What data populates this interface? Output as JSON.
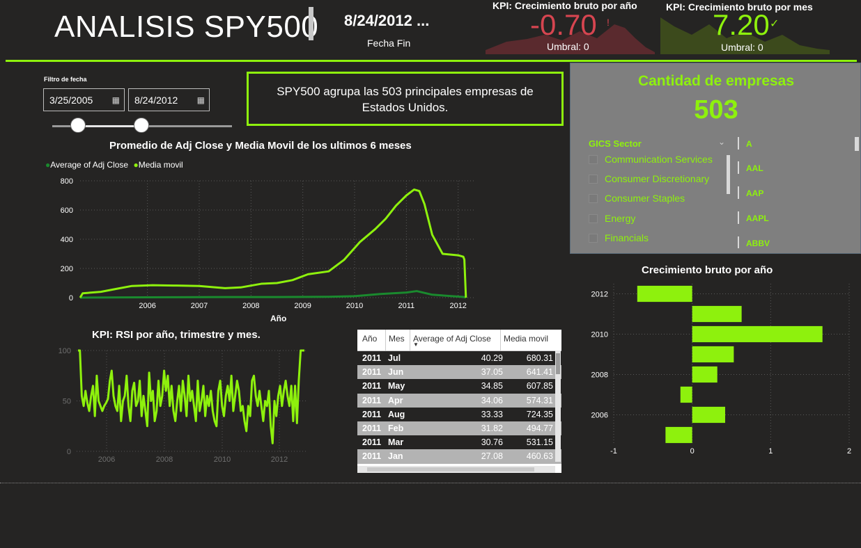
{
  "header": {
    "title": "ANALISIS SPY500",
    "end_date": "8/24/2012 ...",
    "end_date_label": "Fecha Fin"
  },
  "kpi_year": {
    "title": "KPI: Crecimiento bruto por año",
    "value": "-0.70",
    "indicator": "!",
    "threshold": "Umbral: 0",
    "color": "#d64550"
  },
  "kpi_month": {
    "title": "KPI: Crecimiento bruto por mes",
    "value": "7.20",
    "indicator": "✓",
    "threshold": "Umbral: 0",
    "color": "#8ef10d"
  },
  "filter": {
    "label": "Filtro de fecha",
    "start": "3/25/2005",
    "end": "8/24/2012",
    "calendar_icon": "calendar-icon"
  },
  "info_text": "SPY500 agrupa las 503 principales empresas de Estados Unidos.",
  "companies": {
    "title": "Cantidad de empresas",
    "count": "503"
  },
  "sector_slicer": {
    "header": "GICS Sector",
    "items": [
      "Communication Services",
      "Consumer Discretionary",
      "Consumer Staples",
      "Energy",
      "Financials"
    ]
  },
  "ticker_slicer": {
    "items": [
      "A",
      "AAL",
      "AAP",
      "AAPL",
      "ABBV"
    ]
  },
  "colors": {
    "accent": "#8ef10d",
    "dark_green": "#1a8a2e",
    "background": "#252423",
    "panel": "#7f7f7f"
  },
  "chart_data": [
    {
      "type": "line",
      "title": "Promedio de Adj Close y Media Movil de los ultimos 6 meses",
      "xlabel": "Año",
      "ylabel": "",
      "legend_placement": "top-left",
      "grid": true,
      "x_ticks": [
        "2006",
        "2007",
        "2008",
        "2009",
        "2010",
        "2011",
        "2012"
      ],
      "y_ticks": [
        "0",
        "200",
        "400",
        "600",
        "800"
      ],
      "xlim": [
        2005.2,
        2012.8
      ],
      "ylim": [
        0,
        800
      ],
      "series": [
        {
          "name": "Average of Adj Close",
          "color": "#1a8a2e",
          "x": [
            2005.2,
            2006,
            2007,
            2008,
            2009,
            2010,
            2010.5,
            2011,
            2011.5,
            2011.7,
            2012,
            2012.6,
            2012.65
          ],
          "values": [
            0,
            2,
            3,
            4,
            4,
            6,
            10,
            25,
            35,
            45,
            20,
            5,
            0
          ]
        },
        {
          "name": "Media movil",
          "color": "#8ef10d",
          "x": [
            2005.2,
            2005.25,
            2005.6,
            2005.9,
            2006.2,
            2006.6,
            2007,
            2007.5,
            2008,
            2008.3,
            2008.7,
            2009,
            2009.3,
            2009.6,
            2010,
            2010.3,
            2010.6,
            2010.9,
            2011.1,
            2011.3,
            2011.5,
            2011.65,
            2011.75,
            2011.85,
            2012,
            2012.2,
            2012.5,
            2012.6,
            2012.62,
            2012.65
          ],
          "values": [
            0,
            30,
            40,
            60,
            80,
            85,
            83,
            80,
            65,
            70,
            95,
            100,
            120,
            160,
            180,
            260,
            380,
            470,
            540,
            630,
            700,
            740,
            730,
            640,
            430,
            300,
            290,
            280,
            260,
            0
          ]
        }
      ]
    },
    {
      "type": "line",
      "title": "KPI: RSI por año, trimestre y mes.",
      "xlabel": "",
      "ylabel": "",
      "grid": true,
      "x_ticks": [
        "2006",
        "2008",
        "2010",
        "2012"
      ],
      "y_ticks": [
        "0",
        "50",
        "100"
      ],
      "ylim": [
        0,
        100
      ],
      "series": [
        {
          "name": "",
          "color": "#8ef10d",
          "values": [
            100,
            100,
            55,
            45,
            60,
            48,
            40,
            55,
            65,
            35,
            75,
            50,
            45,
            40,
            45,
            48,
            52,
            70,
            80,
            55,
            45,
            40,
            65,
            30,
            50,
            55,
            75,
            45,
            30,
            60,
            68,
            45,
            50,
            70,
            35,
            55,
            40,
            25,
            78,
            50,
            60,
            30,
            40,
            70,
            45,
            55,
            80,
            60,
            75,
            45,
            65,
            40,
            30,
            50,
            65,
            40,
            70,
            55,
            35,
            75,
            50,
            60,
            45,
            30,
            70,
            40,
            50,
            65,
            35,
            55,
            45,
            60,
            40,
            30,
            25,
            60,
            70,
            45,
            35,
            55,
            65,
            50,
            75,
            40,
            55,
            70,
            60,
            40,
            45,
            30,
            20,
            45,
            35,
            70,
            75,
            55,
            45,
            60,
            45,
            30,
            50,
            45,
            60,
            25,
            8,
            50,
            35,
            55,
            65,
            45,
            60,
            70,
            55,
            45,
            65,
            30,
            65,
            28,
            70,
            100,
            100,
            100
          ]
        }
      ]
    },
    {
      "type": "table",
      "columns": [
        "Año",
        "Mes",
        "Average of Adj Close",
        "Media movil"
      ],
      "rows": [
        [
          "2011",
          "Jul",
          "40.29",
          "680.31"
        ],
        [
          "2011",
          "Jun",
          "37.05",
          "641.41"
        ],
        [
          "2011",
          "May",
          "34.85",
          "607.85"
        ],
        [
          "2011",
          "Apr",
          "34.06",
          "574.31"
        ],
        [
          "2011",
          "Aug",
          "33.33",
          "724.35"
        ],
        [
          "2011",
          "Feb",
          "31.82",
          "494.77"
        ],
        [
          "2011",
          "Mar",
          "30.76",
          "531.15"
        ],
        [
          "2011",
          "Jan",
          "27.08",
          "460.63"
        ]
      ]
    },
    {
      "type": "bar",
      "orientation": "horizontal",
      "title": "Crecimiento bruto por año",
      "xlabel": "",
      "ylabel": "",
      "grid": true,
      "categories": [
        "2012",
        "2011",
        "2010",
        "2009",
        "2008",
        "2007",
        "2006",
        "2005"
      ],
      "y_ticks": [
        "2012",
        "2010",
        "2008",
        "2006"
      ],
      "x_ticks": [
        "-1",
        "0",
        "1",
        "2"
      ],
      "xlim": [
        -1,
        2
      ],
      "values": [
        -0.7,
        0.63,
        1.66,
        0.53,
        0.32,
        -0.15,
        0.42,
        -0.34
      ],
      "color": "#8ef10d"
    }
  ]
}
